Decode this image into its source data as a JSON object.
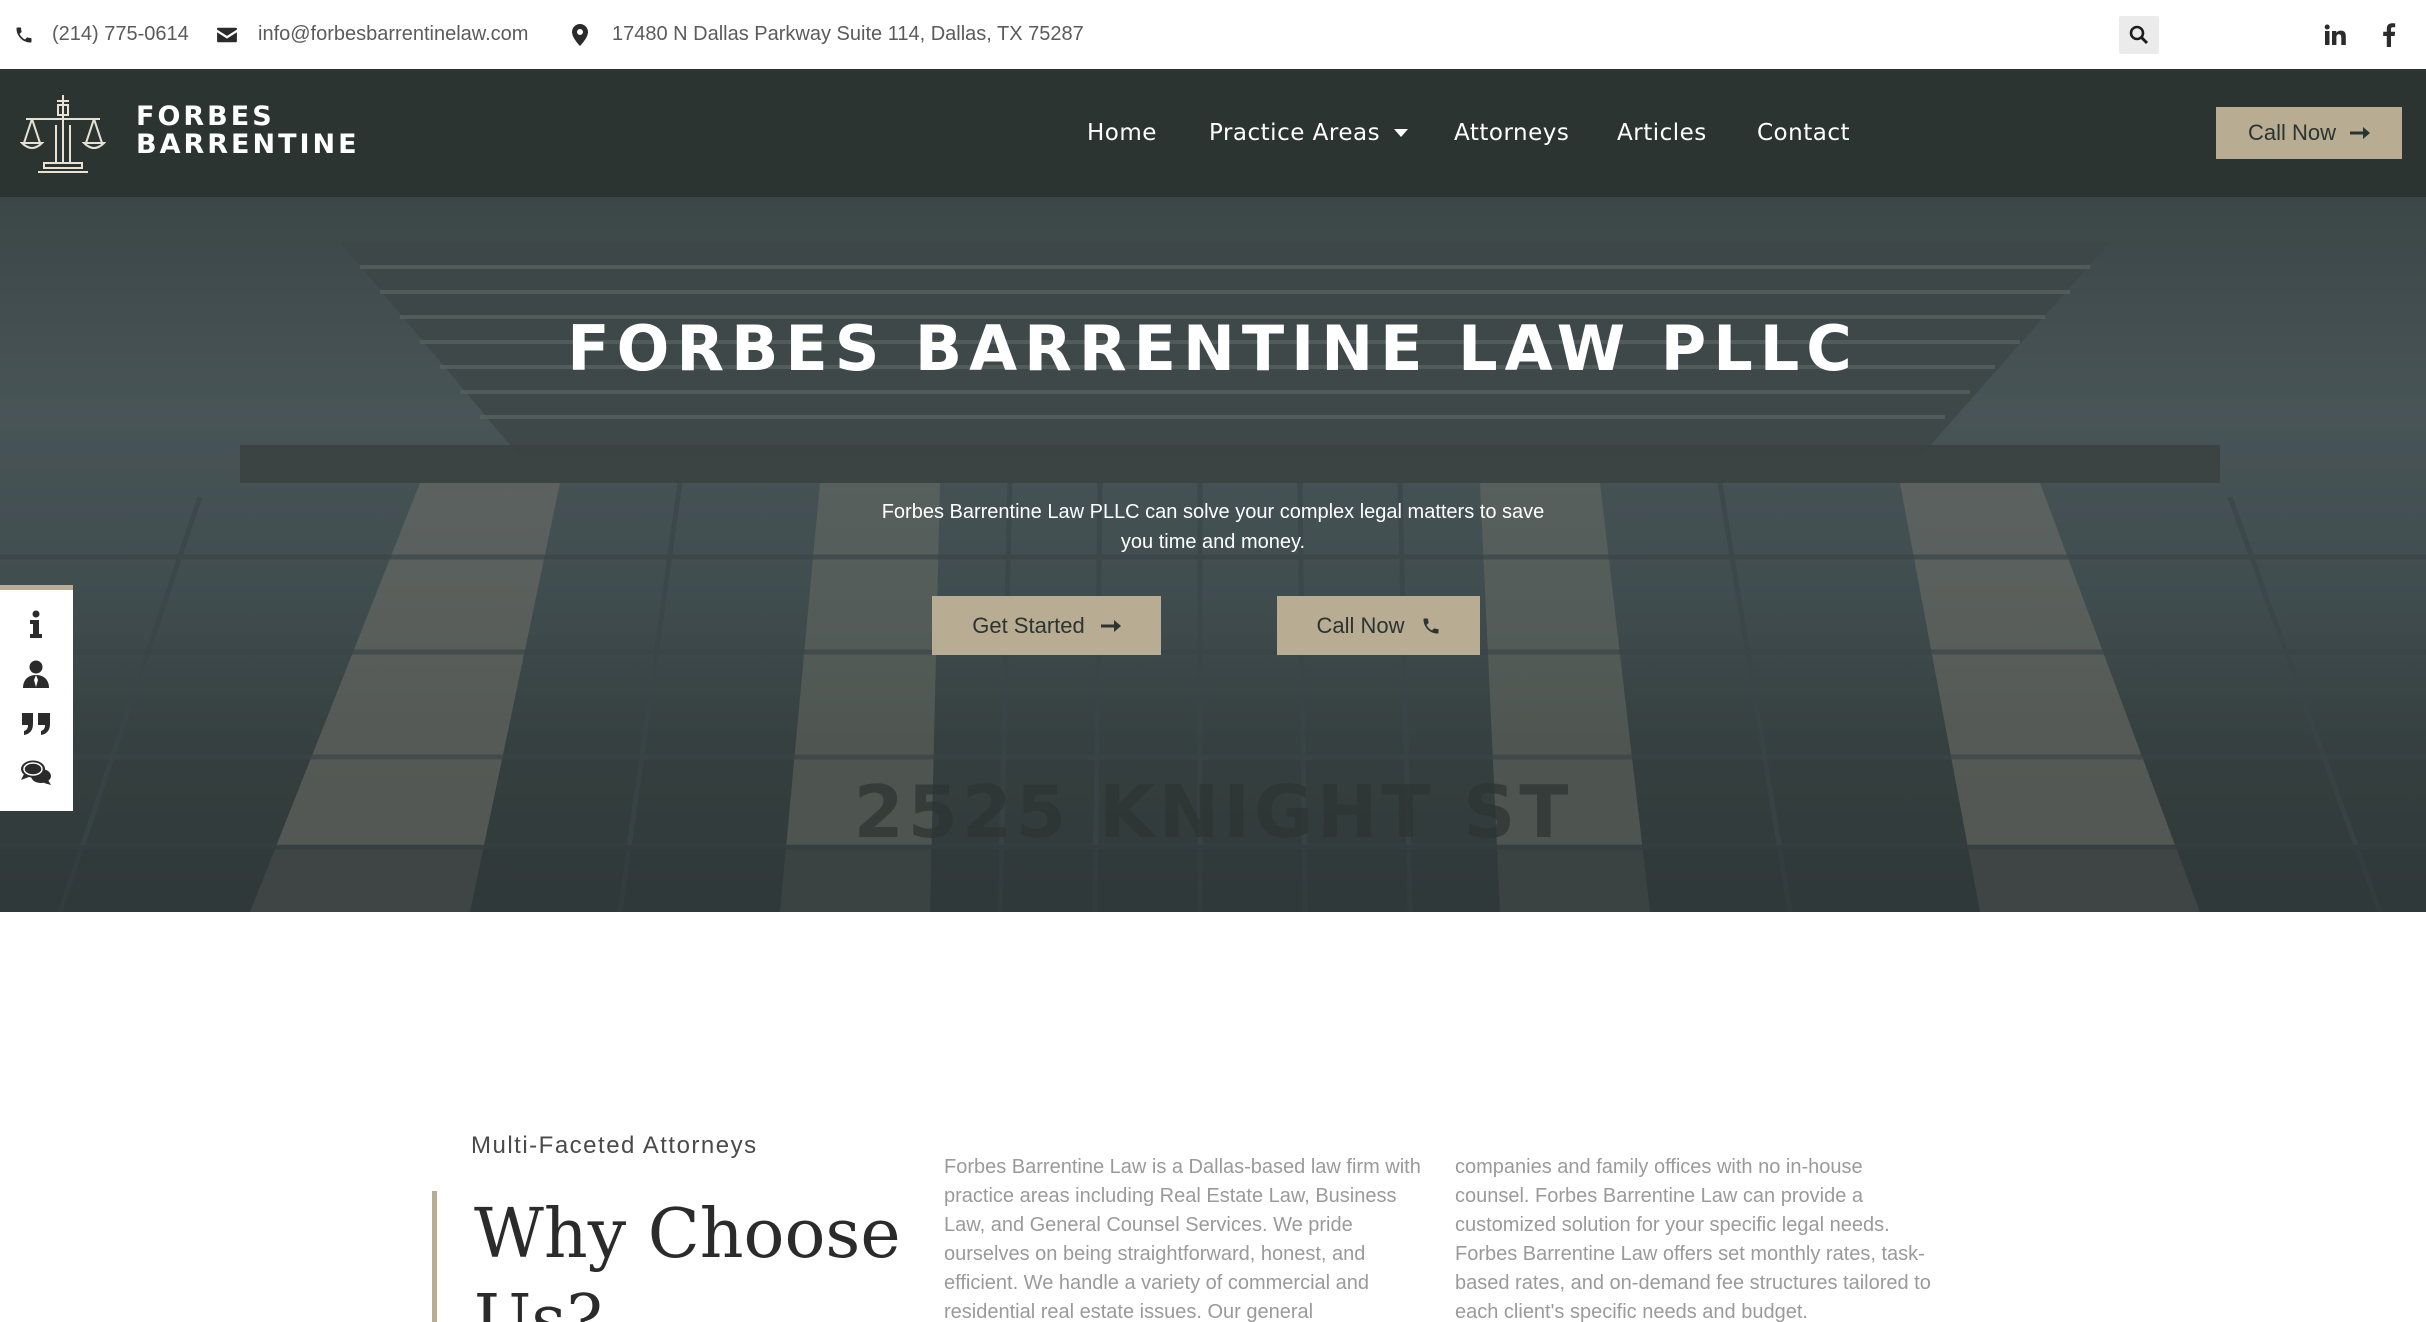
{
  "topbar": {
    "phone": "(214) 775-0614",
    "email": "info@forbesbarrentinelaw.com",
    "address": "17480 N Dallas Parkway Suite 114, Dallas, TX 75287",
    "icons": [
      "phone-icon",
      "envelope-icon",
      "map-marker-icon",
      "search-icon",
      "linkedin-icon",
      "facebook-icon"
    ]
  },
  "nav": {
    "logo_line1": "FORBES",
    "logo_line2": "BARRENTINE",
    "items": [
      "Home",
      "Practice Areas",
      "Attorneys",
      "Articles",
      "Contact"
    ],
    "call_label": "Call Now"
  },
  "hero": {
    "title": "FORBES BARRENTINE LAW PLLC",
    "subtitle": "Forbes Barrentine Law PLLC can solve your complex legal matters to save you time and money.",
    "get_started": "Get Started",
    "call_now": "Call Now",
    "building_sign": "2525 KNIGHT ST"
  },
  "side_widget": {
    "icons": [
      "info-icon",
      "attorney-icon",
      "quote-icon",
      "comments-icon"
    ]
  },
  "content": {
    "kicker": "Multi-Faceted Attorneys",
    "heading": "Why Choose Us?",
    "col1": "Forbes Barrentine Law is a Dallas-based law firm with practice areas including Real Estate Law, Business Law, and General Counsel Services. We pride ourselves on being straightforward, honest, and efficient. We handle a variety of commercial and residential real estate issues. Our general",
    "col2": "companies and family offices with no in-house counsel. Forbes Barrentine Law can provide a customized solution for your specific legal needs. Forbes Barrentine Law offers set monthly rates, task-based rates, and on-demand fee structures tailored to each client's specific needs and budget."
  },
  "colors": {
    "nav_bg": "#2b3430",
    "accent": "#b8ac93"
  }
}
